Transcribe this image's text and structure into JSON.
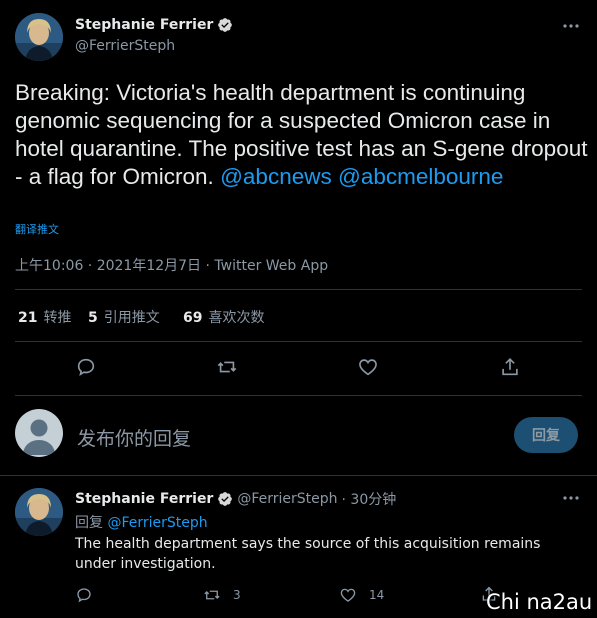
{
  "tweet": {
    "author_name": "Stephanie Ferrier",
    "author_handle": "@FerrierSteph",
    "text_main": "Breaking: Victoria's health department is continuing genomic sequencing for a suspected Omicron case in hotel quarantine. The positive test has an S-gene dropout - a flag for Omicron.",
    "mention_1": "@abcnews",
    "mention_2": "@abcmelbourne",
    "translate_label": "翻译推文",
    "timestamp": "上午10:06 · 2021年12月7日 · Twitter Web App",
    "retweets_count": "21",
    "retweets_label": "转推",
    "quotes_count": "5",
    "quotes_label": "引用推文",
    "likes_count": "69",
    "likes_label": "喜欢次数",
    "more_icon": "ellipsis-icon"
  },
  "actions": {
    "icons": [
      "reply-icon",
      "retweet-icon",
      "like-icon",
      "share-icon"
    ]
  },
  "reply_box": {
    "placeholder": "发布你的回复",
    "button_label": "回复"
  },
  "reply_tweet": {
    "author_name": "Stephanie Ferrier",
    "author_handle": "@FerrierSteph",
    "time_ago": "· 30分钟",
    "replying_to_label": "回复",
    "replying_to_handle": "@FerrierSteph",
    "text": "The health department says the source of this acquisition remains under investigation.",
    "retweet_count": "3",
    "like_count": "14"
  },
  "watermark": "Chi na2au",
  "colors": {
    "background": "#000000",
    "accent": "#1d9bf0",
    "muted": "#8b98a5",
    "divider": "#2f3336"
  }
}
